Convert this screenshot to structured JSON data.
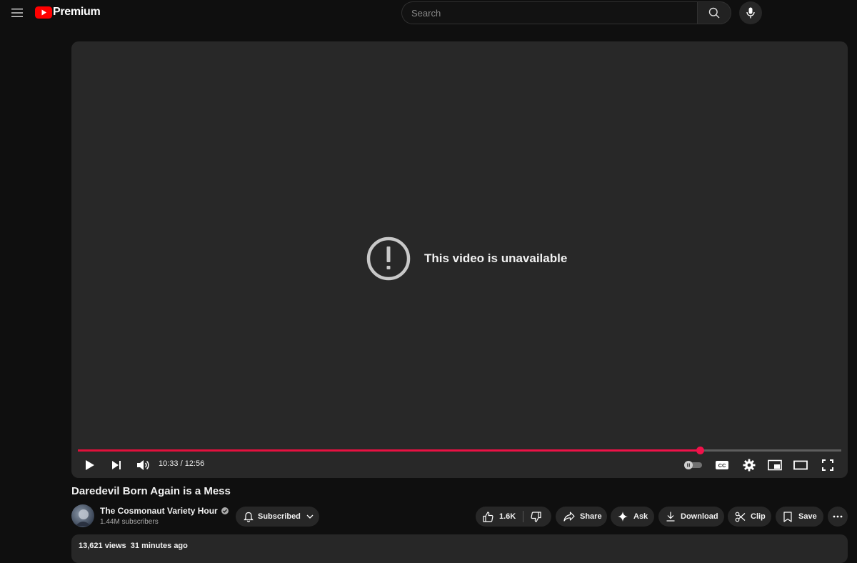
{
  "header": {
    "logo_text": "Premium",
    "search_placeholder": "Search",
    "brand_color": "#ff0000"
  },
  "player": {
    "message": "This video is unavailable",
    "current_time": "10:33",
    "duration": "12:56",
    "time_display": "10:33 / 12:56",
    "progress_fraction": 0.815,
    "progress_color": "#f0124a"
  },
  "video": {
    "title": "Daredevil Born Again is a Mess",
    "channel_name": "The Cosmonaut Variety Hour",
    "subscribers": "1.44M subscribers",
    "subscribe_label": "Subscribed",
    "likes": "1.6K",
    "actions": {
      "share": "Share",
      "ask": "Ask",
      "download": "Download",
      "clip": "Clip",
      "save": "Save"
    },
    "views": "13,621 views",
    "posted": "31 minutes ago"
  }
}
